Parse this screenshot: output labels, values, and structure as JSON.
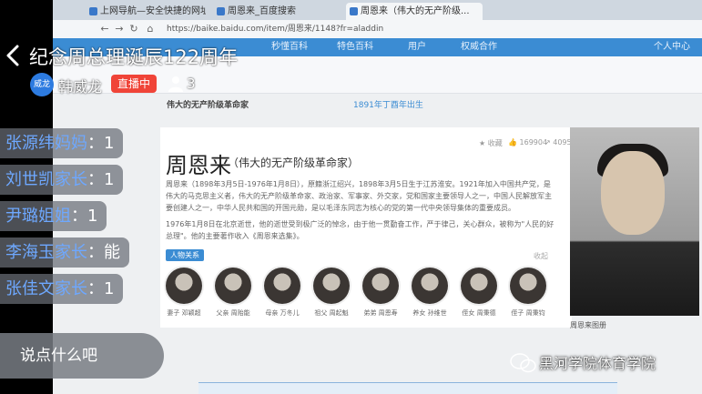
{
  "stream": {
    "title": "纪念周总理诞辰122周年",
    "host_avatar_text": "威龙",
    "host_name": "韩威龙",
    "live_badge": "直播中",
    "viewer_count": "3",
    "chat_placeholder": "说点什么吧",
    "watermark": "黑河学院体育学院"
  },
  "chat": [
    {
      "name": "张源纬妈妈",
      "msg": "：1"
    },
    {
      "name": "刘世凯家长",
      "msg": "：1"
    },
    {
      "name": "尹璐姐姐",
      "msg": "：1"
    },
    {
      "name": "李海玉家长",
      "msg": "：能"
    },
    {
      "name": "张佳文家长",
      "msg": "：1"
    }
  ],
  "browser": {
    "tabs": [
      "上网导航—安全快捷的网址",
      "周恩来_百度搜索",
      "周恩来（伟大的无产阶级..."
    ],
    "url": "https://baike.baidu.com/item/周恩来/1148?fr=aladdin",
    "nav_links": [
      "秒懂百科",
      "特色百科",
      "用户",
      "权威合作",
      "个人中心"
    ],
    "subnav": [
      "伟大的无产阶级革命家",
      "1891年丁酉年出生"
    ],
    "article": {
      "name": "周恩来",
      "subtitle": "（伟大的无产阶级革命家）",
      "stats": [
        "收藏",
        "169904",
        "4095"
      ],
      "para1": "周恩来（1898年3月5日-1976年1月8日），原籍浙江绍兴，1898年3月5日生于江苏淮安。1921年加入中国共产党，是伟大的马克思主义者，伟大的无产阶级革命家、政治家、军事家、外交家，党和国家主要领导人之一，中国人民解放军主要创建人之一，中华人民共和国的开国元勋，是以毛泽东同志为核心的党的第一代中央领导集体的重要成员。",
      "para2": "1976年1月8日在北京逝世，他的逝世受到极广泛的悼念，由于他一贯勤奋工作，严于律己，关心群众，被称为\"人民的好总理\"。他的主要著作收入《周恩来选集》。",
      "tag": "人物关系",
      "tag_right": "收起",
      "relations": [
        "妻子 邓颖超",
        "父亲 周贻能",
        "母亲 万冬儿",
        "祖父 周起魁",
        "弟弟 周恩寿",
        "养女 孙维世",
        "侄女 周秉德",
        "侄子 周秉钧"
      ],
      "portrait_caption": "周恩来图册"
    }
  }
}
